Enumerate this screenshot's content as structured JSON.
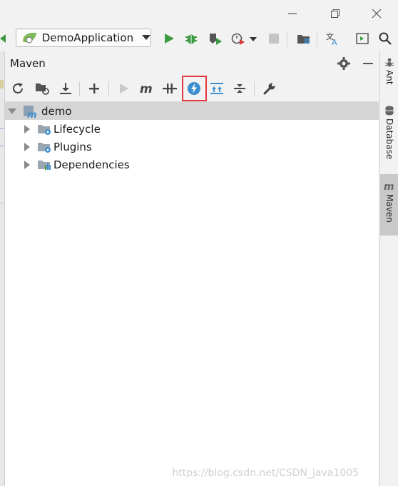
{
  "run_config": {
    "label": "DemoApplication"
  },
  "maven_panel": {
    "title": "Maven",
    "tree": [
      {
        "label": "demo",
        "expanded": true,
        "selected": true
      },
      {
        "label": "Lifecycle"
      },
      {
        "label": "Plugins"
      },
      {
        "label": "Dependencies"
      }
    ]
  },
  "right_tabs": [
    {
      "label": "Ant"
    },
    {
      "label": "Database"
    },
    {
      "label": "Maven",
      "active": true
    }
  ],
  "colors": {
    "highlight_box": "#e0393e",
    "run_green": "#3e9a43",
    "maven_blue": "#3f8fd0"
  },
  "watermark": "https://blog.csdn.net/CSDN_java1005"
}
